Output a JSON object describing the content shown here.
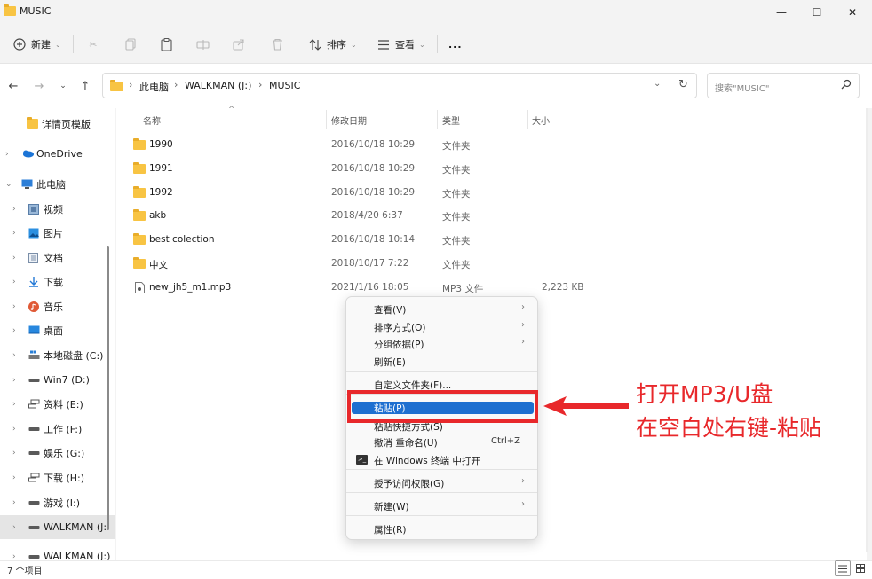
{
  "window": {
    "title": "MUSIC",
    "controls": {
      "minimize": "—",
      "maximize": "☐",
      "close": "✕"
    }
  },
  "toolbar": {
    "new_label": "新建",
    "sort_label": "排序",
    "view_label": "查看",
    "more_label": "..."
  },
  "address": {
    "crumbs": [
      "此电脑",
      "WALKMAN (J:)",
      "MUSIC"
    ],
    "search_placeholder": "搜索\"MUSIC\""
  },
  "sidebar": {
    "items": [
      {
        "label": "详情页模版",
        "icon": "folder-icon",
        "expandable": false
      },
      {
        "label": "OneDrive",
        "icon": "cloud-icon",
        "expandable": true
      },
      {
        "label": "此电脑",
        "icon": "pc-icon",
        "expandable": true,
        "expanded": true
      },
      {
        "label": "视频",
        "icon": "video-icon",
        "expandable": true
      },
      {
        "label": "图片",
        "icon": "picture-icon",
        "expandable": true
      },
      {
        "label": "文档",
        "icon": "document-icon",
        "expandable": true
      },
      {
        "label": "下载",
        "icon": "download-icon",
        "expandable": true
      },
      {
        "label": "音乐",
        "icon": "music-icon",
        "expandable": true
      },
      {
        "label": "桌面",
        "icon": "desktop-icon",
        "expandable": true
      },
      {
        "label": "本地磁盘 (C:)",
        "icon": "system-drive-icon",
        "expandable": true
      },
      {
        "label": "Win7 (D:)",
        "icon": "drive-icon",
        "expandable": true
      },
      {
        "label": "资料 (E:)",
        "icon": "network-drive-icon",
        "expandable": true
      },
      {
        "label": "工作 (F:)",
        "icon": "drive-icon",
        "expandable": true
      },
      {
        "label": "娱乐 (G:)",
        "icon": "drive-icon",
        "expandable": true
      },
      {
        "label": "下载 (H:)",
        "icon": "network-drive-icon",
        "expandable": true
      },
      {
        "label": "游戏 (I:)",
        "icon": "drive-icon",
        "expandable": true
      },
      {
        "label": "WALKMAN (J:",
        "icon": "drive-icon",
        "expandable": true,
        "selected": true
      },
      {
        "label": "WALKMAN (J:)",
        "icon": "drive-icon",
        "expandable": true
      }
    ]
  },
  "files": {
    "columns": [
      "名称",
      "修改日期",
      "类型",
      "大小"
    ],
    "rows": [
      {
        "name": "1990",
        "date": "2016/10/18 10:29",
        "type": "文件夹",
        "size": "",
        "icon": "folder-icon"
      },
      {
        "name": "1991",
        "date": "2016/10/18 10:29",
        "type": "文件夹",
        "size": "",
        "icon": "folder-icon"
      },
      {
        "name": "1992",
        "date": "2016/10/18 10:29",
        "type": "文件夹",
        "size": "",
        "icon": "folder-icon"
      },
      {
        "name": "akb",
        "date": "2018/4/20 6:37",
        "type": "文件夹",
        "size": "",
        "icon": "folder-icon"
      },
      {
        "name": "best colection",
        "date": "2016/10/18 10:14",
        "type": "文件夹",
        "size": "",
        "icon": "folder-icon"
      },
      {
        "name": "中文",
        "date": "2018/10/17 7:22",
        "type": "文件夹",
        "size": "",
        "icon": "folder-icon"
      },
      {
        "name": "new_jh5_m1.mp3",
        "date": "2021/1/16 18:05",
        "type": "MP3 文件",
        "size": "2,223 KB",
        "icon": "audio-file-icon"
      }
    ]
  },
  "context_menu": {
    "items": [
      {
        "label": "查看(V)",
        "submenu": true
      },
      {
        "label": "排序方式(O)",
        "submenu": true
      },
      {
        "label": "分组依据(P)",
        "submenu": true
      },
      {
        "label": "刷新(E)"
      },
      {
        "label": "自定义文件夹(F)..."
      },
      {
        "label": "粘贴(P)",
        "highlighted": true
      },
      {
        "label": "粘贴快捷方式(S)"
      },
      {
        "label": "撤消 重命名(U)",
        "shortcut": "Ctrl+Z"
      },
      {
        "label": "在 Windows 终端 中打开",
        "icon": "terminal-icon"
      },
      {
        "label": "授予访问权限(G)",
        "submenu": true
      },
      {
        "label": "新建(W)",
        "submenu": true
      },
      {
        "label": "属性(R)"
      }
    ]
  },
  "status": {
    "item_count": "7 个项目"
  },
  "annotation": {
    "line1": "打开MP3/U盘",
    "line2": "在空白处右键-粘贴",
    "color": "#e8282b"
  }
}
